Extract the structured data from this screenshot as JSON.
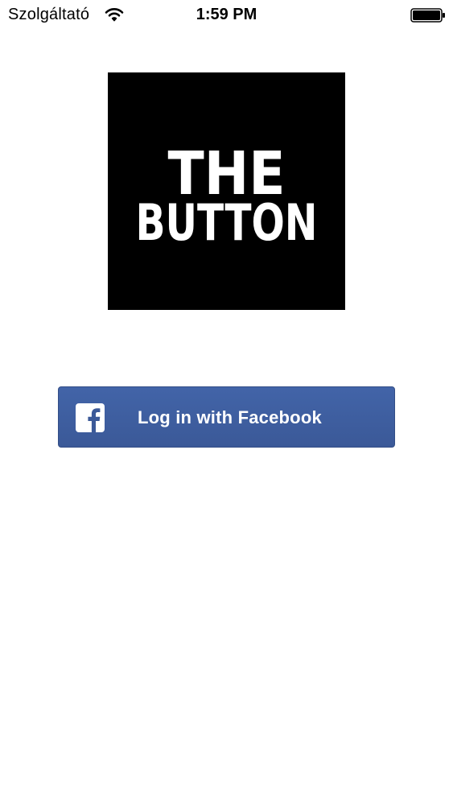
{
  "status_bar": {
    "carrier": "Szolgáltató",
    "time": "1:59 PM",
    "icons": [
      "wifi-icon",
      "battery-icon"
    ]
  },
  "logo": {
    "line1": "THE",
    "line2": "BUTTON",
    "background": "#000000",
    "text_color": "#ffffff"
  },
  "login": {
    "label": "Log in with Facebook",
    "icon": "facebook-icon",
    "color": "#3b5998"
  }
}
